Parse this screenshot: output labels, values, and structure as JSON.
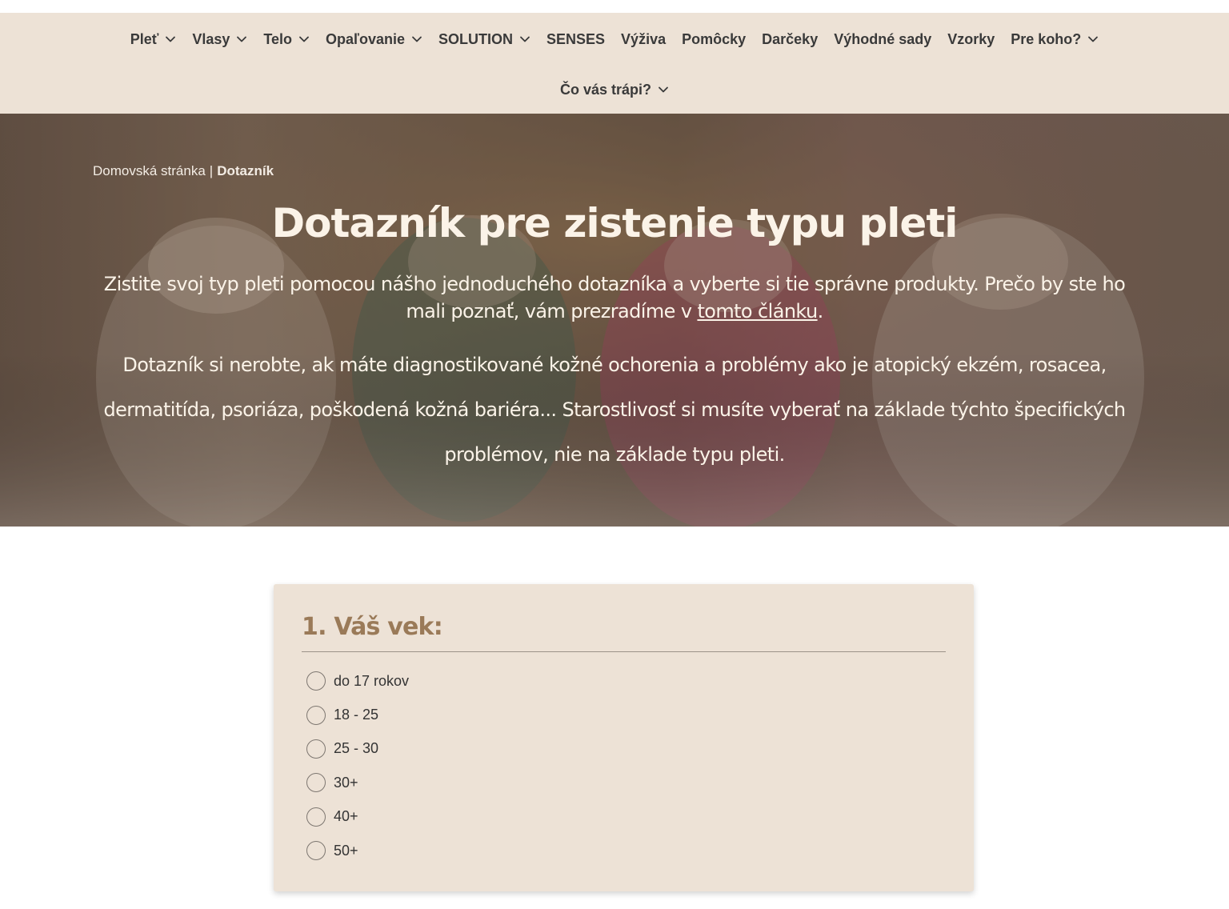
{
  "nav": {
    "row1": [
      {
        "label": "Pleť",
        "has_dropdown": true
      },
      {
        "label": "Vlasy",
        "has_dropdown": true
      },
      {
        "label": "Telo",
        "has_dropdown": true
      },
      {
        "label": "Opaľovanie",
        "has_dropdown": true
      },
      {
        "label": "SOLUTION",
        "has_dropdown": true
      },
      {
        "label": "SENSES",
        "has_dropdown": false
      },
      {
        "label": "Výživa",
        "has_dropdown": false
      },
      {
        "label": "Pomôcky",
        "has_dropdown": false
      },
      {
        "label": "Darčeky",
        "has_dropdown": false
      },
      {
        "label": "Výhodné sady",
        "has_dropdown": false
      },
      {
        "label": "Vzorky",
        "has_dropdown": false
      },
      {
        "label": "Pre koho?",
        "has_dropdown": true
      }
    ],
    "row2": [
      {
        "label": "Čo vás trápi?",
        "has_dropdown": true
      }
    ]
  },
  "hero": {
    "breadcrumb": {
      "home": "Domovská stránka",
      "separator": "|",
      "current": "Dotazník"
    },
    "title": "Dotazník pre zistenie typu pleti",
    "intro_before_link": "Zistite svoj typ pleti pomocou nášho jednoduchého dotazníka a vyberte si tie správne produkty. Prečo by ste ho mali poznať, vám prezradíme v ",
    "intro_link": "tomto článku",
    "intro_after_link": ".",
    "warning": "Dotazník si nerobte, ak máte diagnostikované kožné ochorenia a problémy ako je atopický ekzém, rosacea, dermatitída, psoriáza, poškodená kožná bariéra... Starostlivosť si musíte vyberať na základe týchto špecifických problémov, nie na základe typu pleti."
  },
  "quiz": {
    "question_title": "1. Váš vek:",
    "options": [
      "do 17 rokov",
      "18 - 25",
      "25 - 30",
      "30+",
      "40+",
      "50+"
    ]
  },
  "colors": {
    "nav_bg": "#ede2d6",
    "card_bg": "#ede2d6",
    "question_accent": "#9a7a58",
    "hero_text": "#fbf3e8"
  }
}
